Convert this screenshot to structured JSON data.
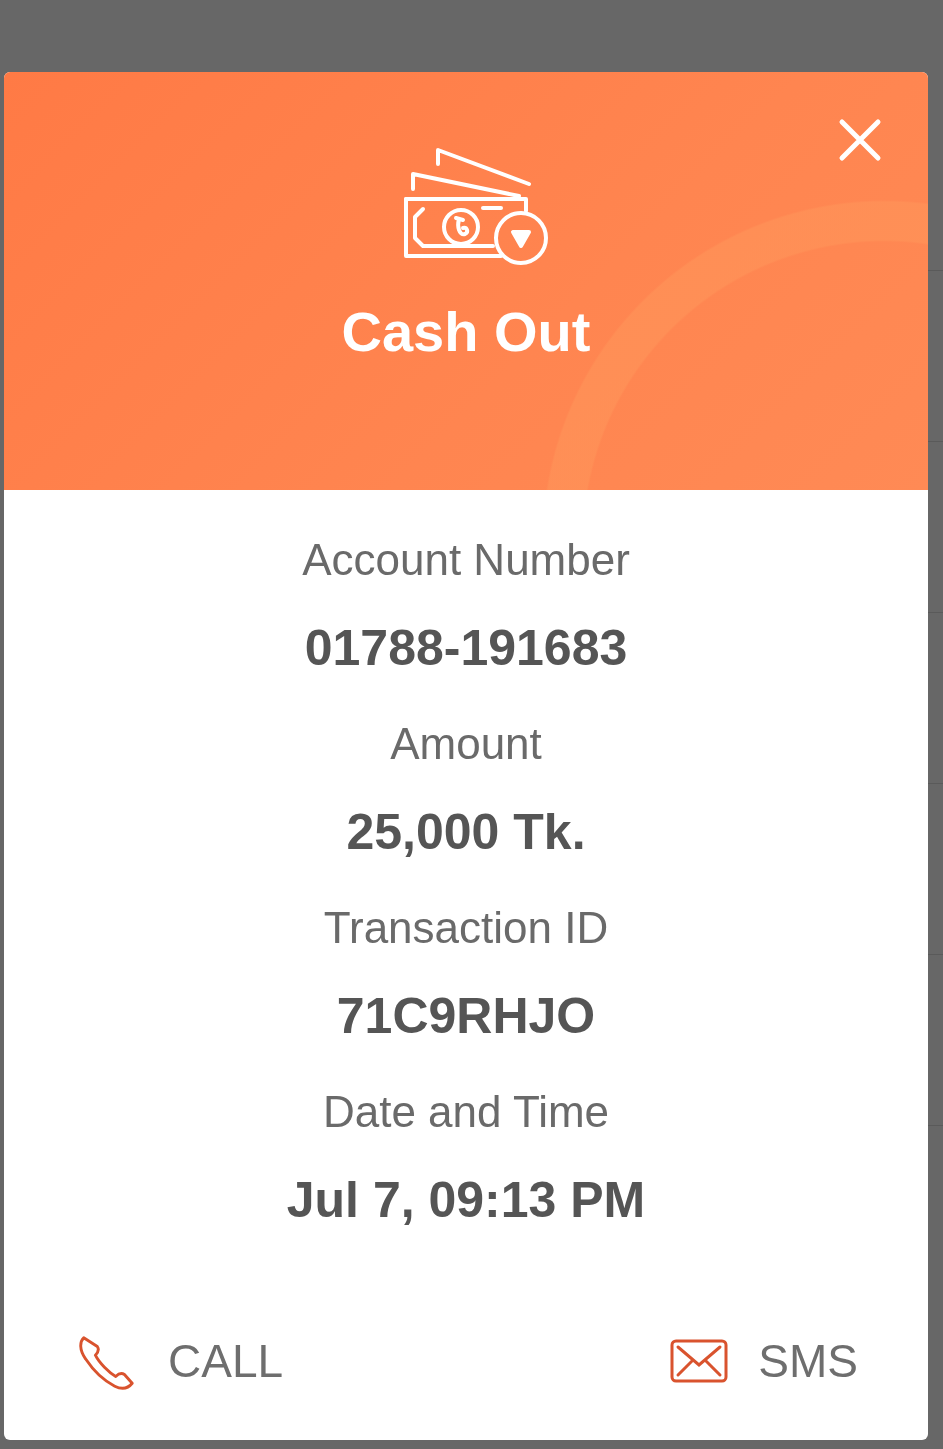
{
  "dialog": {
    "title": "Cash Out",
    "fields": [
      {
        "label": "Account Number",
        "value": "01788-191683"
      },
      {
        "label": "Amount",
        "value": "25,000 Tk."
      },
      {
        "label": "Transaction ID",
        "value": "71C9RHJO"
      },
      {
        "label": "Date and Time",
        "value": "Jul 7, 09:13 PM"
      }
    ],
    "actions": [
      {
        "kind": "call",
        "label": "CALL"
      },
      {
        "kind": "sms",
        "label": "SMS"
      }
    ]
  }
}
